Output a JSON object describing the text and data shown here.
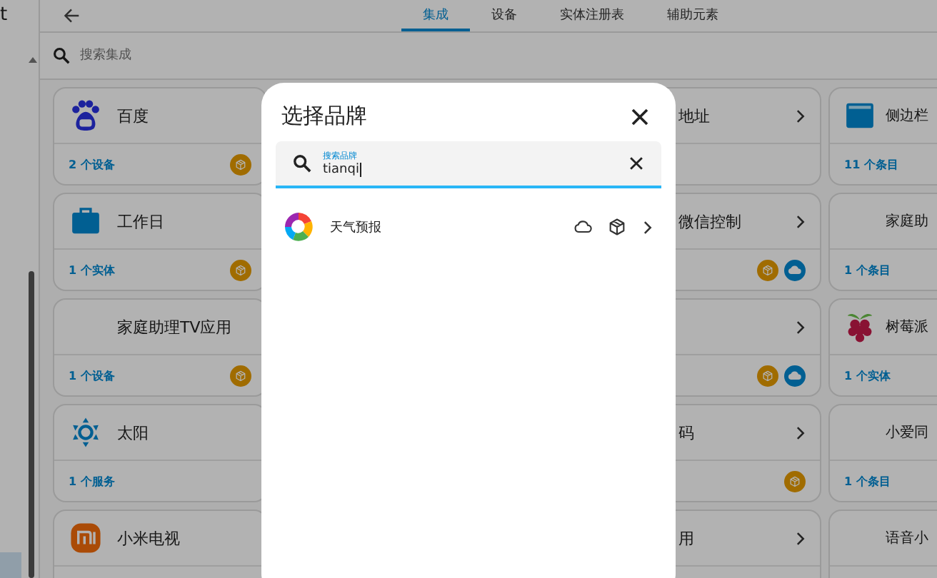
{
  "sidebar": {
    "title": "t"
  },
  "tabs": [
    {
      "label": "集成",
      "selected": true
    },
    {
      "label": "设备",
      "selected": false
    },
    {
      "label": "实体注册表",
      "selected": false
    },
    {
      "label": "辅助元素",
      "selected": false
    }
  ],
  "search": {
    "placeholder": "搜索集成"
  },
  "cards": [
    {
      "title": "百度",
      "footer": "2 个设备",
      "package": true,
      "cloud": false
    },
    {
      "title": "地址",
      "package": false,
      "cloud": false
    },
    {
      "title": "侧边栏",
      "footer": "11 个条目",
      "package": false,
      "cloud": false
    },
    {
      "title": "工作日",
      "footer": "1 个实体",
      "package": true,
      "cloud": false
    },
    {
      "title": "微信控制",
      "package": true,
      "cloud": true
    },
    {
      "title": "家庭助",
      "footer": "1 个条目",
      "package": false,
      "cloud": false
    },
    {
      "title": "家庭助理TV应用",
      "footer": "1 个设备",
      "package": true,
      "cloud": false
    },
    {
      "package": true,
      "cloud": true
    },
    {
      "title": "树莓派",
      "footer": "1 个实体",
      "package": false,
      "cloud": false
    },
    {
      "title": "太阳",
      "footer": "1 个服务",
      "package": false,
      "cloud": false
    },
    {
      "title": "码",
      "package": true,
      "cloud": false
    },
    {
      "title": "小爱同",
      "footer": "1 个条目",
      "package": false,
      "cloud": false
    },
    {
      "title": "小米电视",
      "package": false,
      "cloud": false
    },
    {
      "title": "用",
      "package": false,
      "cloud": false
    },
    {
      "title": "语音小",
      "package": false,
      "cloud": false
    }
  ],
  "dialog": {
    "title": "选择品牌",
    "search_label": "搜索品牌",
    "search_value": "tianqi",
    "items": [
      {
        "name": "天气预报",
        "cloud": true,
        "package": true
      }
    ]
  }
}
